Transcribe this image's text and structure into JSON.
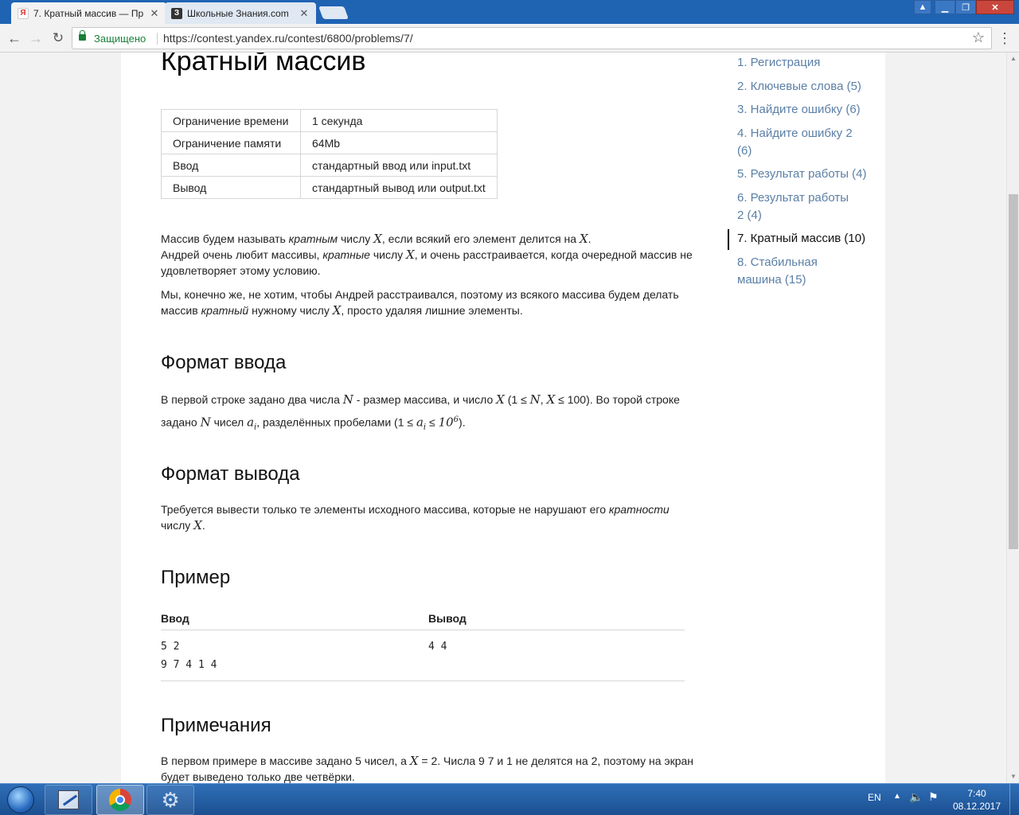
{
  "browser": {
    "tabs": [
      {
        "favicon": "Я",
        "title": "7. Кратный массив — Пр",
        "active": true
      },
      {
        "favicon": "З",
        "title": "Школьные Знания.com",
        "active": false
      }
    ],
    "secure_label": "Защищено",
    "url": "https://contest.yandex.ru/contest/6800/problems/7/"
  },
  "problem": {
    "title": "Кратный массив",
    "limits": [
      {
        "key": "Ограничение времени",
        "value": "1 секунда"
      },
      {
        "key": "Ограничение памяти",
        "value": "64Mb"
      },
      {
        "key": "Ввод",
        "value": "стандартный ввод или input.txt"
      },
      {
        "key": "Вывод",
        "value": "стандартный вывод или output.txt"
      }
    ],
    "statement": {
      "p1_a": "Массив будем называть ",
      "p1_em1": "кратным",
      "p1_b": " числу ",
      "p1_c": ", если всякий его элемент делится на ",
      "p1_d": ".",
      "p1_e": "Андрей очень любит массивы, ",
      "p1_em2": "кратные",
      "p1_f": " числу ",
      "p1_g": ", и очень расстраивается, когда очередной массив не удовлетворяет этому условию.",
      "p2_a": "Мы, конечно же, не хотим, чтобы Андрей расстраивался, поэтому из всякого массива будем делать массив ",
      "p2_em": "кратный",
      "p2_b": " нужному числу ",
      "p2_c": ", просто удаляя лишние элементы."
    },
    "input_format": {
      "heading": "Формат ввода",
      "a": "В первой строке задано два числа ",
      "b": " - размер массива, и число ",
      "c": " (1 ≤ ",
      "d": ", ",
      "e": " ≤ 100). Во торой строке задано ",
      "f": " чисел ",
      "g": ", разделённых пробелами (1 ≤ ",
      "h": " ≤ ",
      "i": ")."
    },
    "output_format": {
      "heading": "Формат вывода",
      "a": "Требуется вывести только те элементы исходного массива, которые не нарушают его ",
      "em": "кратности",
      "b": " числу ",
      "c": "."
    },
    "example": {
      "heading": "Пример",
      "input_label": "Ввод",
      "output_label": "Вывод",
      "input": "5 2\n9 7 4 1 4",
      "output": "4 4"
    },
    "notes": {
      "heading": "Примечания",
      "a": "В первом примере в массиве задано 5 чисел, а ",
      "b": " = 2. Числа 9 7 и 1 не делятся на 2, поэтому на экран будет выведено только две четвёрки."
    },
    "math": {
      "X": "X",
      "N": "N",
      "a": "a",
      "i": "i",
      "ten": "10",
      "six": "6"
    }
  },
  "sidebar": {
    "items": [
      {
        "label": "1. Регистрация",
        "active": false
      },
      {
        "label": "2. Ключевые слова (5)",
        "active": false
      },
      {
        "label": "3. Найдите ошибку (6)",
        "active": false
      },
      {
        "label": "4. Найдите ошибку 2 (6)",
        "active": false
      },
      {
        "label": "5. Результат работы (4)",
        "active": false
      },
      {
        "label": "6. Результат работы 2 (4)",
        "active": false
      },
      {
        "label": "7. Кратный массив (10)",
        "active": true
      },
      {
        "label": "8. Стабильная машина (15)",
        "active": false
      }
    ]
  },
  "taskbar": {
    "language": "EN",
    "time": "7:40",
    "date": "08.12.2017"
  },
  "colors": {
    "link": "#5b7fa6",
    "secure": "#188038",
    "tabbar": "#1f63b3"
  }
}
